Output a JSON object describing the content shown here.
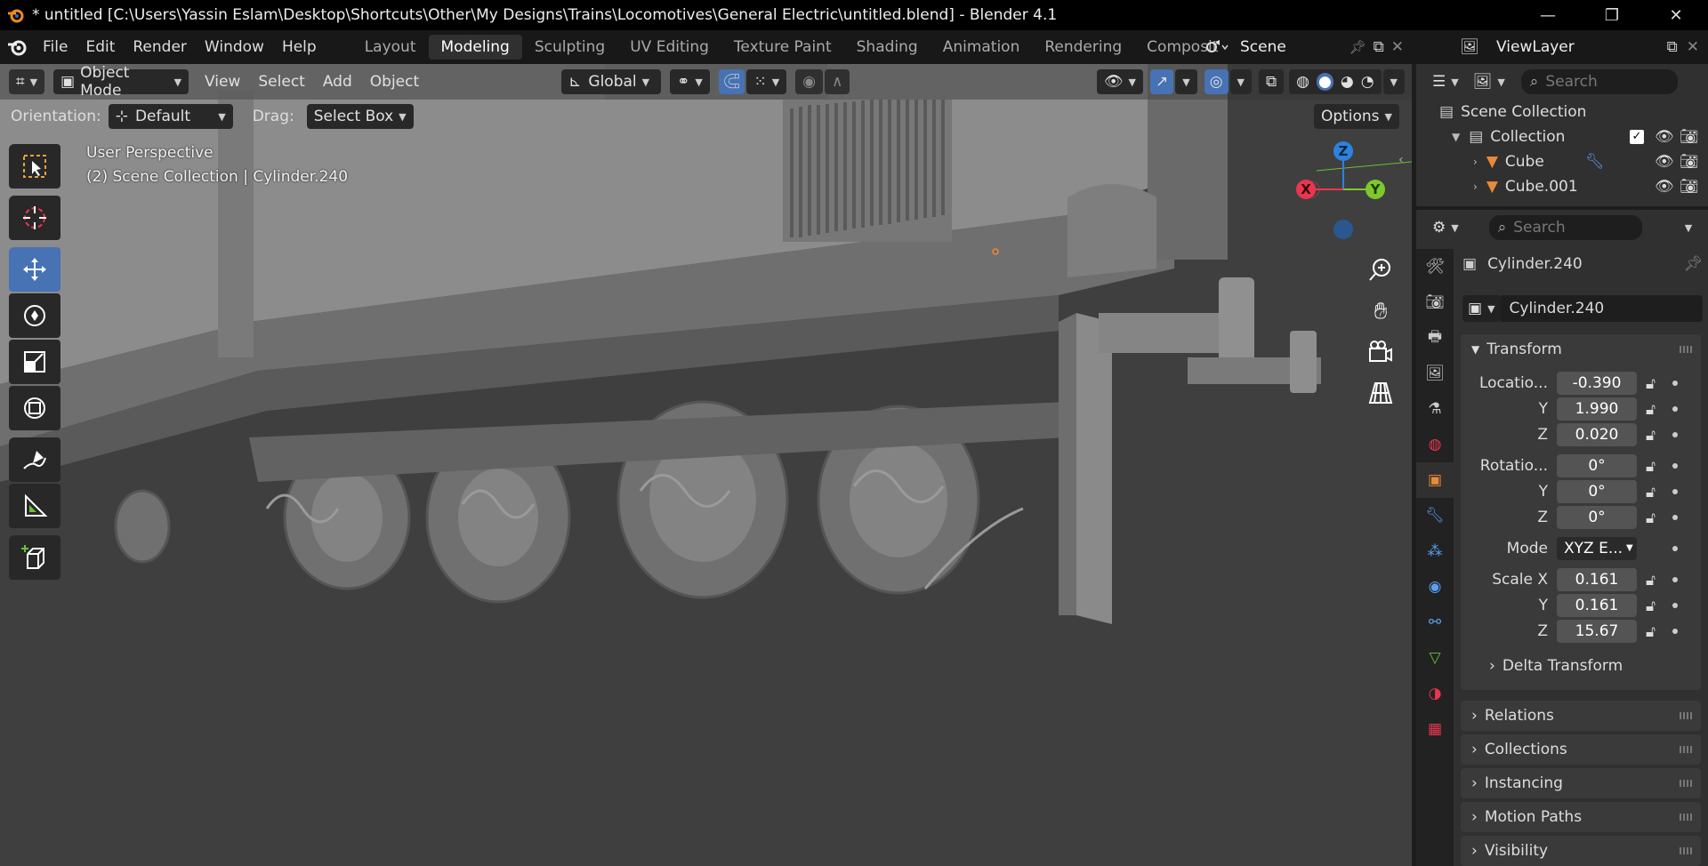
{
  "window": {
    "title": "* untitled [C:\\Users\\Yassin Eslam\\Desktop\\Shortcuts\\Other\\My Designs\\Trains\\Locomotives\\General Electric\\untitled.blend] - Blender 4.1",
    "minimize": "—",
    "maximize": "❐",
    "close": "✕"
  },
  "menu": {
    "items": [
      "File",
      "Edit",
      "Render",
      "Window",
      "Help"
    ]
  },
  "workspaces": {
    "tabs": [
      "Layout",
      "Modeling",
      "Sculpting",
      "UV Editing",
      "Texture Paint",
      "Shading",
      "Animation",
      "Rendering",
      "Compositing"
    ],
    "active": "Modeling"
  },
  "scene": {
    "name": "Scene"
  },
  "viewlayer": {
    "name": "ViewLayer"
  },
  "viewport": {
    "mode": "Object Mode",
    "menus": [
      "View",
      "Select",
      "Add",
      "Object"
    ],
    "transform_orientation": "Global",
    "orientation_label": "Orientation:",
    "orientation_value": "Default",
    "drag_label": "Drag:",
    "drag_value": "Select Box",
    "options_label": "Options",
    "overlay_line1": "User Perspective",
    "overlay_line2": "(2) Scene Collection | Cylinder.240",
    "gizmo": {
      "x": "X",
      "y": "Y",
      "z": "Z"
    }
  },
  "outliner": {
    "search_placeholder": "Search",
    "root": "Scene Collection",
    "collection": "Collection",
    "objects": [
      "Cube",
      "Cube.001"
    ]
  },
  "properties": {
    "search_placeholder": "Search",
    "object_name": "Cylinder.240",
    "datablock_name": "Cylinder.240",
    "transform": {
      "title": "Transform",
      "location_label": "Locatio...",
      "location": [
        "-0.390",
        "1.990",
        "0.020"
      ],
      "rotation_label": "Rotatio...",
      "rotation": [
        "0°",
        "0°",
        "0°"
      ],
      "mode_label": "Mode",
      "mode_value": "XYZ E...",
      "scale_label": "Scale X",
      "scale": [
        "0.161",
        "0.161",
        "15.67"
      ],
      "y_label": "Y",
      "z_label": "Z",
      "delta": "Delta Transform"
    },
    "panels": [
      "Relations",
      "Collections",
      "Instancing",
      "Motion Paths",
      "Visibility"
    ]
  },
  "colors": {
    "accent": "#4772b3",
    "axis_x": "#e8364f",
    "axis_y": "#7ec82d",
    "axis_z": "#2d82e0",
    "object_orange": "#e88a3a"
  }
}
